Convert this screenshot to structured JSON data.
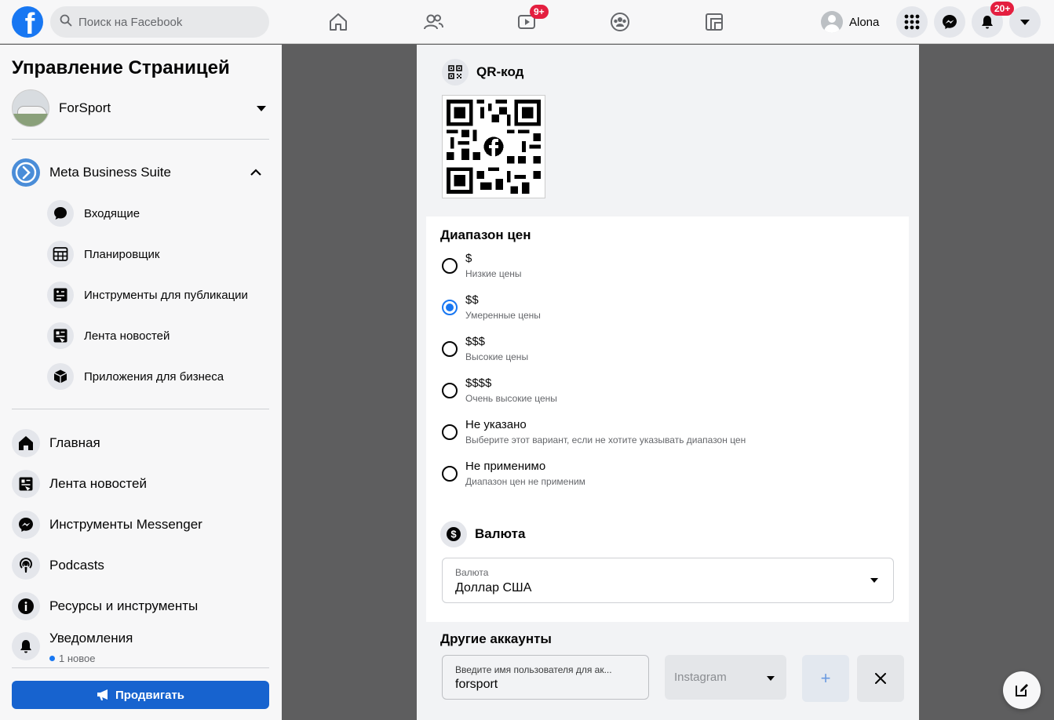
{
  "topbar": {
    "logo_letter": "f",
    "search_placeholder": "Поиск на Facebook",
    "nav": [
      {
        "icon": "home-icon"
      },
      {
        "icon": "friends-icon"
      },
      {
        "icon": "watch-icon",
        "badge": "9+"
      },
      {
        "icon": "groups-icon"
      },
      {
        "icon": "gaming-icon"
      }
    ],
    "profile_name": "Alona",
    "notifications_badge": "20+"
  },
  "sidebar": {
    "title": "Управление Страницей",
    "page_name": "ForSport",
    "business_suite": "Meta Business Suite",
    "sub_items": [
      {
        "label": "Входящие",
        "icon": "chat-bubble-icon"
      },
      {
        "label": "Планировщик",
        "icon": "calendar-grid-icon"
      },
      {
        "label": "Инструменты для публикации",
        "icon": "publishing-tools-icon"
      },
      {
        "label": "Лента новостей",
        "icon": "news-feed-icon"
      },
      {
        "label": "Приложения для бизнеса",
        "icon": "box-icon"
      }
    ],
    "main_items": [
      {
        "label": "Главная",
        "icon": "home-icon"
      },
      {
        "label": "Лента новостей",
        "icon": "news-feed-icon"
      },
      {
        "label": "Инструменты Messenger",
        "icon": "messenger-icon"
      },
      {
        "label": "Podcasts",
        "icon": "podcast-icon"
      },
      {
        "label": "Ресурсы и инструменты",
        "icon": "info-icon"
      },
      {
        "label": "Уведомления",
        "icon": "bell-icon"
      }
    ],
    "notifications_sub": "1 новое",
    "promote_label": "Продвигать"
  },
  "qr": {
    "title": "QR-код"
  },
  "price_range": {
    "title": "Диапазон цен",
    "options": [
      {
        "main": "$",
        "sub": "Низкие цены",
        "selected": false
      },
      {
        "main": "$$",
        "sub": "Умеренные цены",
        "selected": true
      },
      {
        "main": "$$$",
        "sub": "Высокие цены",
        "selected": false
      },
      {
        "main": "$$$$",
        "sub": "Очень высокие цены",
        "selected": false
      },
      {
        "main": "Не указано",
        "sub": "Выберите этот вариант, если не хотите указывать диапазон цен",
        "selected": false
      },
      {
        "main": "Не применимо",
        "sub": "Диапазон цен не применим",
        "selected": false
      }
    ]
  },
  "currency": {
    "title": "Валюта",
    "field_label": "Валюта",
    "value": "Доллар США"
  },
  "other_accounts": {
    "title": "Другие аккаунты",
    "input_label": "Введите имя пользователя для ак...",
    "input_value": "forsport",
    "platform": "Instagram",
    "add_label": "+"
  },
  "colors": {
    "brand": "#1877f2",
    "badge": "#e41e3f"
  }
}
